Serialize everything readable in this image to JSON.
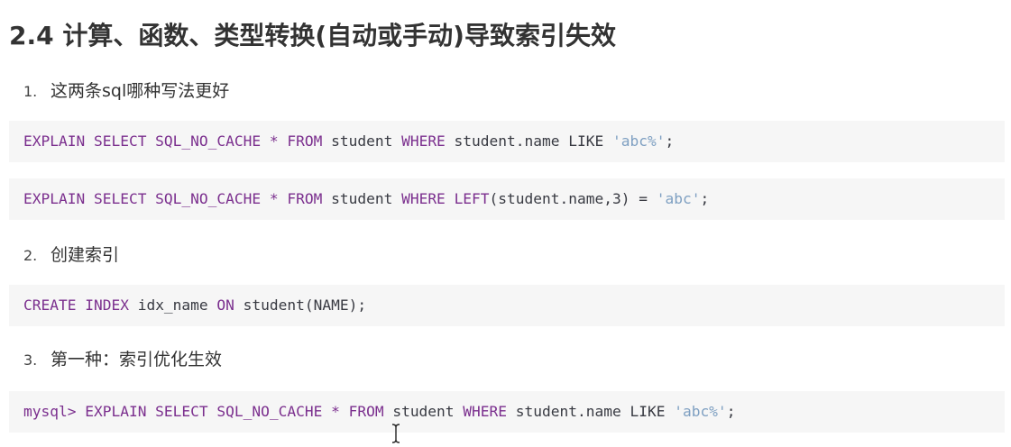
{
  "heading": "2.4 计算、函数、类型转换(自动或手动)导致索引失效",
  "items": [
    {
      "num": "1.",
      "text": "这两条sql哪种写法更好"
    },
    {
      "num": "2.",
      "text": "创建索引"
    },
    {
      "num": "3.",
      "text": "第一种：索引优化生效"
    }
  ],
  "code": {
    "line1": {
      "t1": "EXPLAIN SELECT SQL_NO_CACHE * ",
      "k1": "FROM",
      "t2": " student ",
      "k2": "WHERE",
      "t3": " student.name LIKE ",
      "s1": "'abc%'",
      "t4": ";"
    },
    "line2": {
      "t1": "EXPLAIN SELECT SQL_NO_CACHE * ",
      "k1": "FROM",
      "t2": " student ",
      "k2": "WHERE",
      "t3": " ",
      "k3": "LEFT",
      "t4": "(student.name,3) = ",
      "s1": "'abc'",
      "t5": ";"
    },
    "line3": {
      "k1": "CREATE INDEX",
      "t1": " idx_name ",
      "k2": "ON",
      "t2": " student(NAME);"
    },
    "line4": {
      "t1": "mysql> EXPLAIN SELECT SQL_NO_CACHE * ",
      "k1": "FROM",
      "t2": " student ",
      "k2": "WHERE",
      "t3": " student.name LIKE ",
      "s1": "'abc%'",
      "t4": ";"
    }
  }
}
